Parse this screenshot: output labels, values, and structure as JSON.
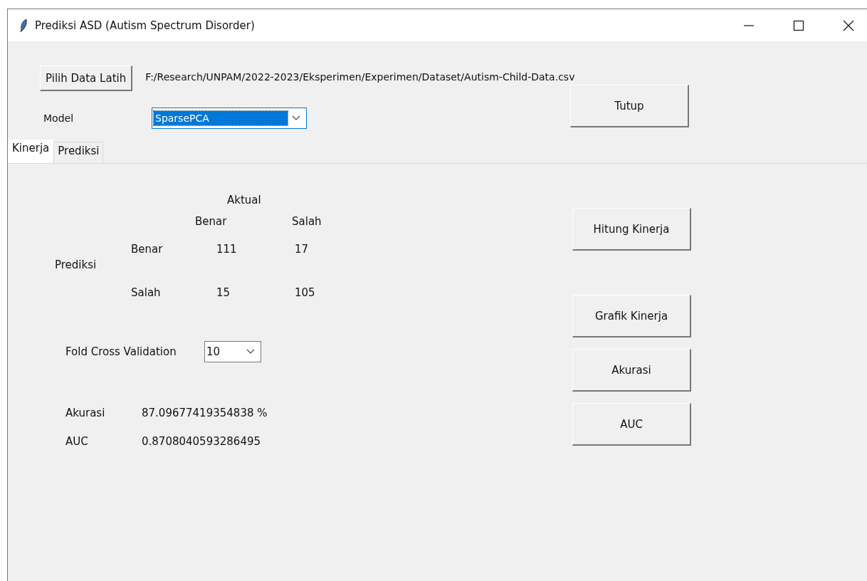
{
  "window": {
    "title": "Prediksi ASD (Autism Spectrum Disorder)"
  },
  "load_button": "Pilih Data Latih",
  "file_path": "F:/Research/UNPAM/2022-2023/Eksperimen/Experimen/Dataset/Autism-Child-Data.csv",
  "close_button": "Tutup",
  "model": {
    "label": "Model",
    "value": "SparsePCA"
  },
  "tabs": [
    {
      "label": "Kinerja",
      "selected": true
    },
    {
      "label": "Prediksi",
      "selected": false
    }
  ],
  "matrix": {
    "actual_label": "Aktual",
    "predicted_label": "Prediksi",
    "columns": [
      "Benar",
      "Salah"
    ],
    "rows": [
      {
        "label": "Benar",
        "values": [
          "111",
          "17"
        ]
      },
      {
        "label": "Salah",
        "values": [
          "15",
          "105"
        ]
      }
    ]
  },
  "fold": {
    "label": "Fold Cross Validation",
    "value": "10"
  },
  "results": [
    {
      "label": "Akurasi",
      "value": "87.09677419354838 %"
    },
    {
      "label": "AUC",
      "value": "0.8708040593286495"
    }
  ],
  "action_buttons": [
    "Hitung Kinerja",
    "Grafik Kinerja",
    "Akurasi",
    "AUC"
  ]
}
